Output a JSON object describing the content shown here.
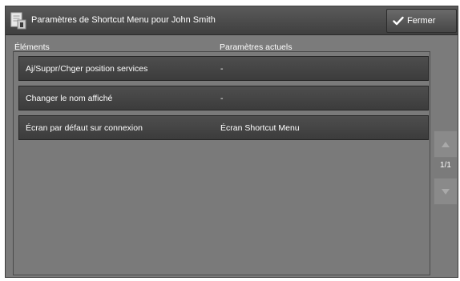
{
  "header": {
    "title": "Paramètres de Shortcut Menu pour John Smith",
    "close_label": "Fermer"
  },
  "columns": {
    "elements": "Éléments",
    "settings": "Paramètres actuels"
  },
  "rows": [
    {
      "label": "Aj/Suppr/Chger position services",
      "value": "-"
    },
    {
      "label": "Changer le nom affiché",
      "value": "-"
    },
    {
      "label": "Écran par défaut sur connexion",
      "value": "Écran Shortcut Menu"
    }
  ],
  "pager": {
    "page_indicator": "1/1"
  },
  "icons": {
    "title": "document-settings-icon",
    "close": "checkmark-icon",
    "scroll_up": "triangle-up-icon",
    "scroll_down": "triangle-down-icon"
  },
  "colors": {
    "background": "#7b7b7b",
    "row": "#474747",
    "text": "#ffffff"
  }
}
